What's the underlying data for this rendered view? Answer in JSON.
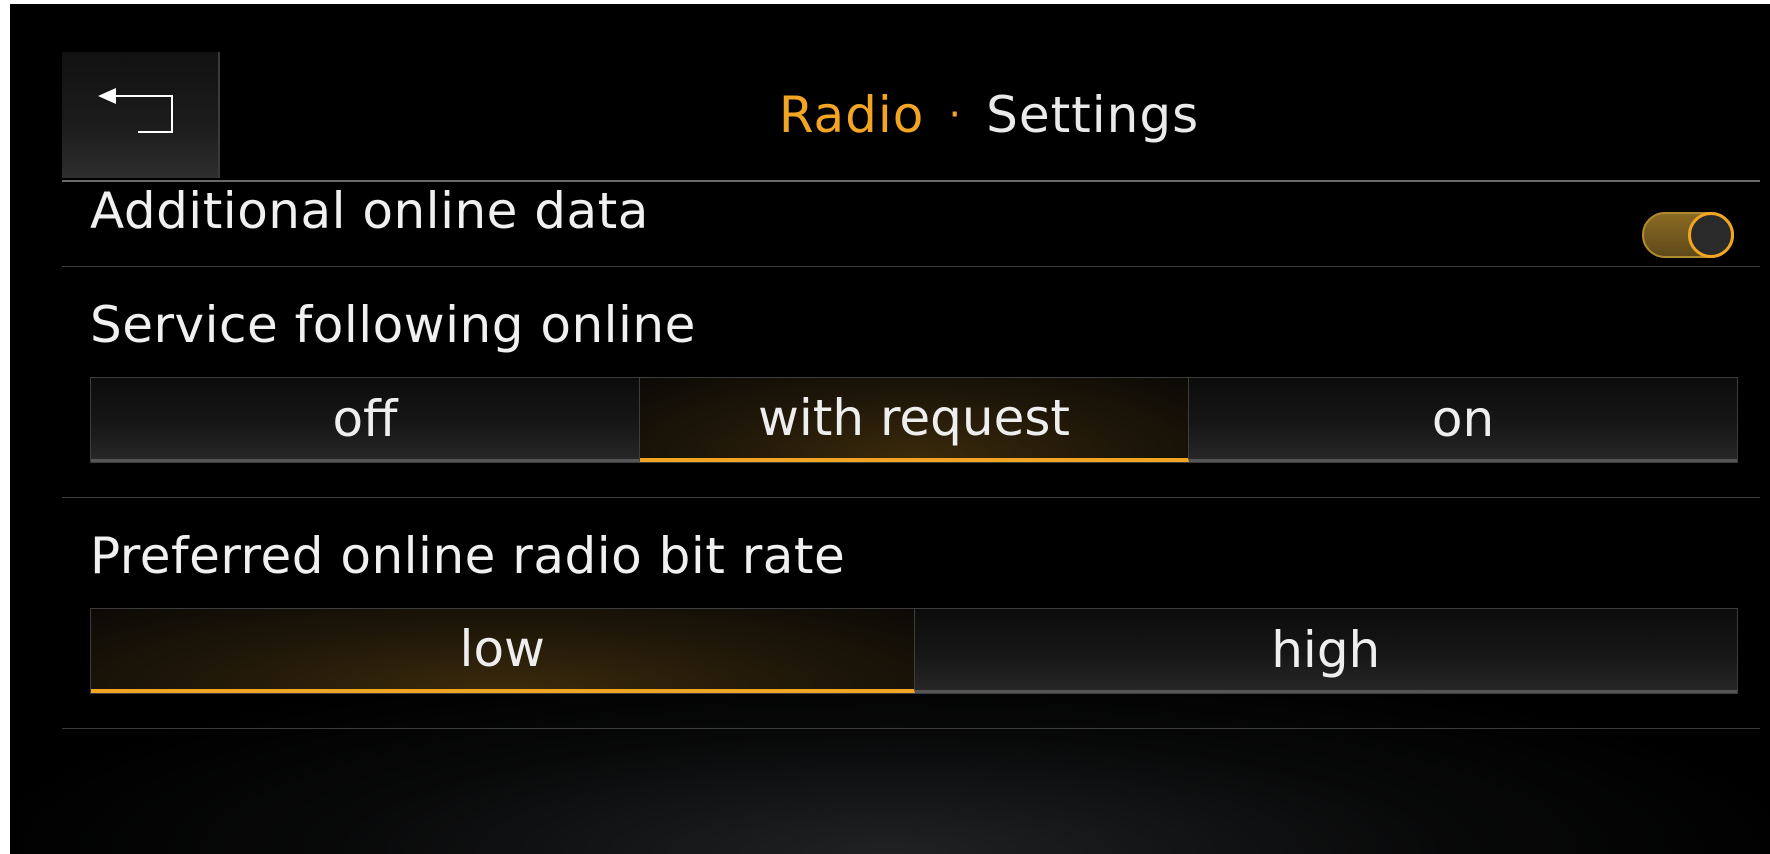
{
  "header": {
    "title_primary": "Radio",
    "title_separator": "·",
    "title_secondary": "Settings",
    "back_icon": "back-arrow-icon"
  },
  "settings": {
    "additional_online_data": {
      "label": "Additional online data",
      "toggle_state": "on"
    },
    "service_following_online": {
      "label": "Service following online",
      "options": [
        "off",
        "with request",
        "on"
      ],
      "selected": "with request"
    },
    "preferred_bit_rate": {
      "label": "Preferred online radio bit rate",
      "options": [
        "low",
        "high"
      ],
      "selected": "low"
    }
  },
  "colors": {
    "accent": "#f2a522",
    "background": "#000000",
    "text": "#f0f0f0"
  }
}
